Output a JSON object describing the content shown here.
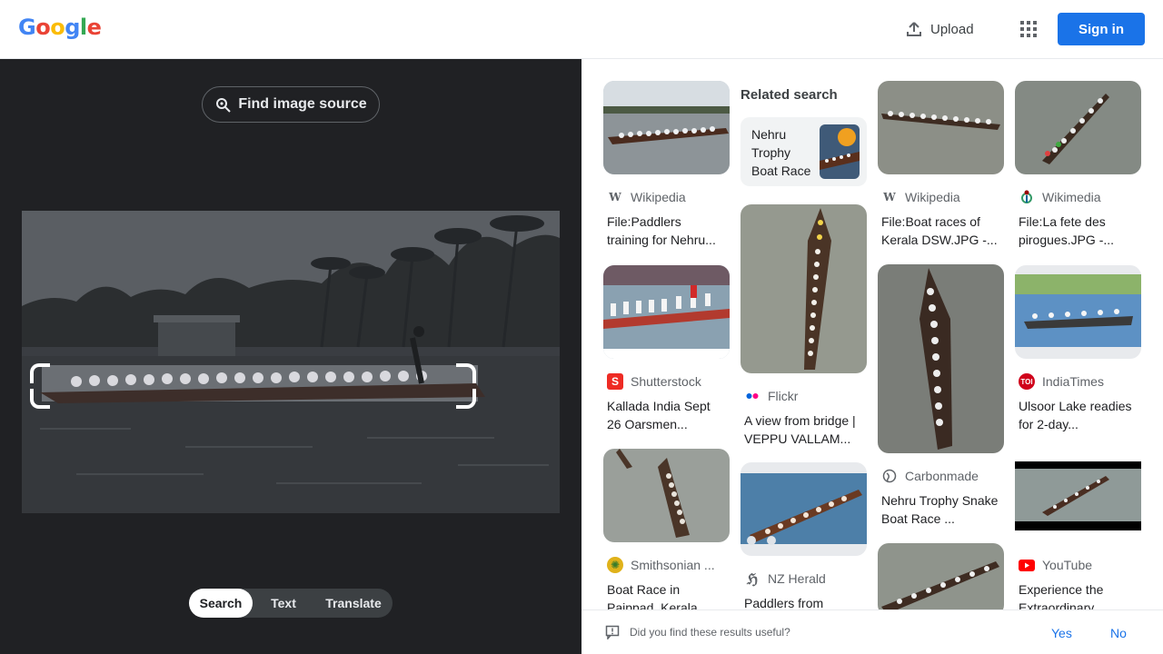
{
  "header": {
    "logo": [
      "G",
      "o",
      "o",
      "g",
      "l",
      "e"
    ],
    "logo_colors": [
      "#4285f4",
      "#ea4335",
      "#fbbc05",
      "#4285f4",
      "#34a853",
      "#ea4335"
    ],
    "upload_label": "Upload",
    "signin_label": "Sign in"
  },
  "left": {
    "find_source_label": "Find image source",
    "tabs": [
      "Search",
      "Text",
      "Translate"
    ],
    "active_tab": "Search"
  },
  "results": {
    "related_heading": "Related search",
    "related_query": "Nehru Trophy Boat Race",
    "cards": [
      {
        "source": "Wikipedia",
        "favicon": "wikipedia-icon",
        "title": "File:Paddlers training for Nehru..."
      },
      {
        "source": "Shutterstock",
        "favicon": "shutterstock-icon",
        "title": "Kallada India Sept 26 Oarsmen..."
      },
      {
        "source": "Smithsonian ...",
        "favicon": "smithsonian-icon",
        "title": "Boat Race in Paippad, Kerala..."
      },
      {
        "source": "Flickr",
        "favicon": "flickr-icon",
        "title": "A view from bridge | VEPPU VALLAM..."
      },
      {
        "source": "NZ Herald",
        "favicon": "nz-herald-icon",
        "title": "Paddlers from"
      },
      {
        "source": "Wikipedia",
        "favicon": "wikipedia-icon",
        "title": "File:Boat races of Kerala DSW.JPG -..."
      },
      {
        "source": "Carbonmade",
        "favicon": "globe-icon",
        "title": "Nehru Trophy Snake Boat Race ..."
      },
      {
        "source": "Wikimedia",
        "favicon": "wikimedia-icon",
        "title": "File:La fete des pirogues.JPG -..."
      },
      {
        "source": "IndiaTimes",
        "favicon": "indiatimes-icon",
        "title": "Ulsoor Lake readies for 2-day..."
      },
      {
        "source": "YouTube",
        "favicon": "youtube-icon",
        "title": "Experience the Extraordinary..."
      }
    ]
  },
  "feedback": {
    "question": "Did you find these results useful?",
    "yes": "Yes",
    "no": "No"
  },
  "colors": {
    "accent": "#1a73e8",
    "panel_dark": "#202124"
  }
}
